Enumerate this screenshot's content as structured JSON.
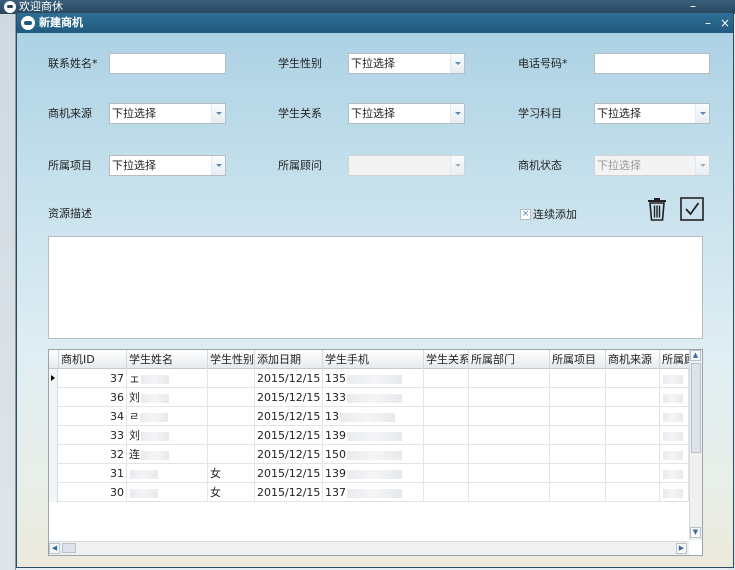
{
  "parent_window": {
    "title": "欢迎商休",
    "min_label": "–"
  },
  "dialog": {
    "title": "新建商机",
    "min_label": "–",
    "close_label": "×"
  },
  "form": {
    "contact_name_label": "联系姓名*",
    "student_gender_label": "学生性别",
    "gender_value": "下拉选择",
    "phone_label": "电话号码*",
    "opportunity_source_label": "商机来源",
    "source_value": "下拉选择",
    "student_relation_label": "学生关系",
    "relation_value": "下拉选择",
    "subject_label": "学习科目",
    "subject_value": "下拉选择",
    "project_label": "所属项目",
    "project_value": "下拉选择",
    "advisor_label": "所属顾问",
    "advisor_value": "",
    "status_label": "商机状态",
    "status_value": "下拉选择",
    "description_label": "资源描述",
    "continuous_add_label": "连续添加",
    "continuous_add_check": "×"
  },
  "grid": {
    "columns": [
      "商机ID",
      "学生姓名",
      "学生性别",
      "添加日期",
      "学生手机",
      "学生关系",
      "所属部门",
      "所属项目",
      "商机来源",
      "所属顾"
    ],
    "rows": [
      {
        "id": "37",
        "name": "ェ",
        "gender": "",
        "date": "2015/12/15",
        "phone": "135"
      },
      {
        "id": "36",
        "name": "刘",
        "gender": "",
        "date": "2015/12/15",
        "phone": "133"
      },
      {
        "id": "34",
        "name": "ㄹ",
        "gender": "",
        "date": "2015/12/15",
        "phone": "13"
      },
      {
        "id": "33",
        "name": "刘",
        "gender": "",
        "date": "2015/12/15",
        "phone": "139"
      },
      {
        "id": "32",
        "name": "连",
        "gender": "",
        "date": "2015/12/15",
        "phone": "150"
      },
      {
        "id": "31",
        "name": "",
        "gender": "女",
        "date": "2015/12/15",
        "phone": "139"
      },
      {
        "id": "30",
        "name": "",
        "gender": "女",
        "date": "2015/12/15",
        "phone": "137"
      }
    ]
  },
  "icons": {
    "delete": "trash-icon",
    "confirm": "checkmark-icon"
  }
}
